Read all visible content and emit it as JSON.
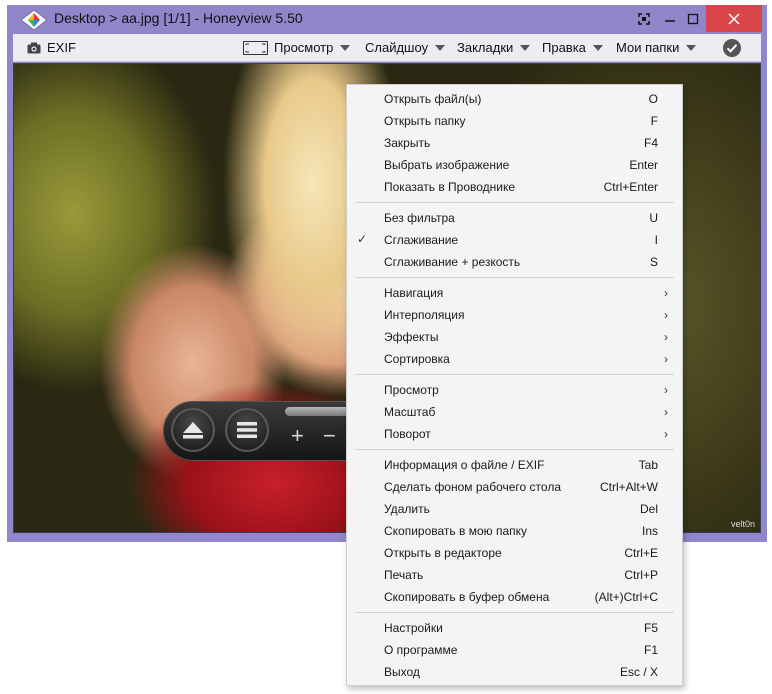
{
  "window": {
    "title": "Desktop > aa.jpg [1/1] - Honeyview 5.50"
  },
  "toolbar": {
    "exif_label": "EXIF",
    "view_label": "Просмотр",
    "slideshow_label": "Слайдшоу",
    "bookmarks_label": "Закладки",
    "edit_label": "Правка",
    "folders_label": "Мои папки"
  },
  "viewer": {
    "watermark": "velt0n"
  },
  "controls": {
    "plus_label": "+",
    "minus_label": "−"
  },
  "menu": {
    "groups": [
      [
        {
          "label": "Открыть файл(ы)",
          "shortcut": "O"
        },
        {
          "label": "Открыть папку",
          "shortcut": "F"
        },
        {
          "label": "Закрыть",
          "shortcut": "F4"
        },
        {
          "label": "Выбрать изображение",
          "shortcut": "Enter"
        },
        {
          "label": "Показать в Проводнике",
          "shortcut": "Ctrl+Enter"
        }
      ],
      [
        {
          "label": "Без фильтра",
          "shortcut": "U"
        },
        {
          "label": "Сглаживание",
          "shortcut": "I",
          "checked": true
        },
        {
          "label": "Сглаживание + резкость",
          "shortcut": "S"
        }
      ],
      [
        {
          "label": "Навигация",
          "submenu": true
        },
        {
          "label": "Интерполяция",
          "submenu": true
        },
        {
          "label": "Эффекты",
          "submenu": true
        },
        {
          "label": "Сортировка",
          "submenu": true
        }
      ],
      [
        {
          "label": "Просмотр",
          "submenu": true
        },
        {
          "label": "Масштаб",
          "submenu": true
        },
        {
          "label": "Поворот",
          "submenu": true
        }
      ],
      [
        {
          "label": "Информация о файле / EXIF",
          "shortcut": "Tab"
        },
        {
          "label": "Сделать фоном рабочего стола",
          "shortcut": "Ctrl+Alt+W"
        },
        {
          "label": "Удалить",
          "shortcut": "Del"
        },
        {
          "label": "Скопировать в мою папку",
          "shortcut": "Ins"
        },
        {
          "label": "Открыть в редакторе",
          "shortcut": "Ctrl+E"
        },
        {
          "label": "Печать",
          "shortcut": "Ctrl+P"
        },
        {
          "label": "Скопировать в буфер обмена",
          "shortcut": "(Alt+)Ctrl+C"
        }
      ],
      [
        {
          "label": "Настройки",
          "shortcut": "F5"
        },
        {
          "label": "О программе",
          "shortcut": "F1"
        },
        {
          "label": "Выход",
          "shortcut": "Esc / X"
        }
      ]
    ]
  },
  "colors": {
    "frame": "#8f87c9",
    "close_button": "#d9464a",
    "menu_background": "#f4f4f4"
  }
}
